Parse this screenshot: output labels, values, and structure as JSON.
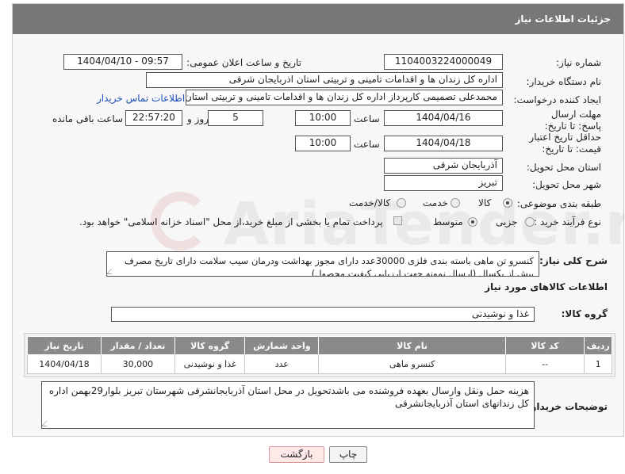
{
  "header": {
    "title": "جزئیات اطلاعات نیاز"
  },
  "fields": {
    "need_number_label": "شماره نیاز:",
    "need_number": "1104003224000049",
    "announce_label": "تاریخ و ساعت اعلان عمومی:",
    "announce_value": "1404/04/10 - 09:57",
    "buyer_org_label": "نام دستگاه خریدار:",
    "buyer_org": "اداره کل زندان ها و اقدامات تامینی و تربیتی استان اذربایجان شرقی",
    "creator_label": "ایجاد کننده درخواست:",
    "creator": "محمدعلی تصمیمی کارپرداز اداره کل زندان ها و اقدامات تامینی و تربیتی استان",
    "contact_link": "اطلاعات تماس خریدار",
    "reply_deadline_label": "مهلت ارسال پاسخ: تا تاریخ:",
    "reply_date": "1404/04/16",
    "time_label": "ساعت",
    "reply_time": "10:00",
    "days_value": "5",
    "days_label": "روز و",
    "remaining_time": "22:57:20",
    "remaining_label": "ساعت باقی مانده",
    "price_deadline_label": "حداقل تاریخ اعتبار قیمت: تا تاریخ:",
    "price_date": "1404/04/18",
    "price_time": "10:00",
    "province_label": "استان محل تحویل:",
    "province": "آذربایجان شرقی",
    "city_label": "شهر محل تحویل:",
    "city": "تبریز",
    "category_label": "طبقه بندی موضوعی:",
    "category_options": [
      "کالا",
      "خدمت",
      "کالا/خدمت"
    ],
    "purchase_label": "نوع فرآیند خرید :",
    "purchase_options": [
      "جزیی",
      "متوسط"
    ],
    "payment_note": "پرداخت تمام یا بخشی از مبلغ خرید،از محل \"اسناد خزانه اسلامی\" خواهد بود.",
    "description_label": "شرح کلی نیاز:",
    "description": "کنسرو تن ماهی باسته بندی فلزی 30000عدد دارای مجوز بهداشت ودرمان سیب سلامت دارای تاریخ مصرف بیش از یکسال (ارسال نمونه  جهت ارزیابی کیفیت محصول)",
    "goods_info_title": "اطلاعات کالاهای مورد نیاز",
    "goods_group_label": "گروه کالا:",
    "goods_group": "غذا و نوشیدنی"
  },
  "table": {
    "headers": [
      "ردیف",
      "کد کالا",
      "نام کالا",
      "واحد شمارش",
      "گروه کالا",
      "تعداد / مقدار",
      "تاریخ نیاز"
    ],
    "rows": [
      [
        "1",
        "--",
        "کنسرو ماهی",
        "عدد",
        "غذا و نوشیدنی",
        "30,000",
        "1404/04/18"
      ]
    ]
  },
  "buyer_notes_label": "توضیحات خریدار:",
  "buyer_notes": "هزینه حمل ونقل وارسال بعهده فروشنده می باشدتحویل در محل استان آذربایجانشرقی شهرستان تبریز بلوار29بهمن اداره کل زندانهای استان آذربایجانشرقی",
  "buttons": {
    "print": "چاپ",
    "back": "بازگشت"
  },
  "watermark": {
    "text": "AriaTender.neT",
    "colors": {
      "ring": "#c23b3b",
      "text": "#888888"
    }
  }
}
